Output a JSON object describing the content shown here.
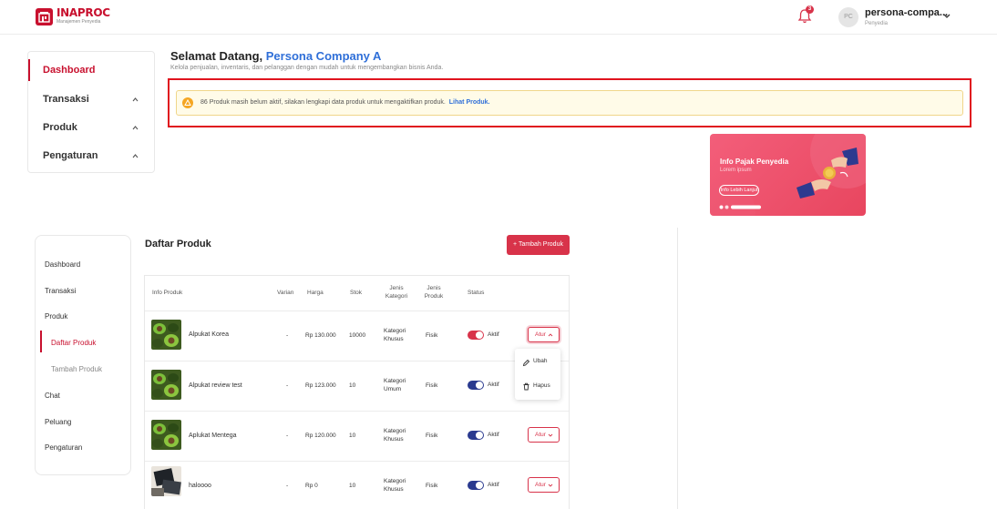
{
  "header": {
    "logo_title": "INAPROC",
    "logo_sub": "Manajemen Penyedia",
    "notification_count": "3",
    "avatar_initials": "PC",
    "user_name": "persona-compa...",
    "user_role": "Penyedia"
  },
  "top_sidebar": {
    "items": [
      {
        "label": "Dashboard"
      },
      {
        "label": "Transaksi"
      },
      {
        "label": "Produk"
      },
      {
        "label": "Pengaturan"
      }
    ]
  },
  "welcome": {
    "greeting": "Selamat Datang, ",
    "company": "Persona Company A",
    "subtitle": "Kelola penjualan, inventaris, dan pelanggan dengan mudah untuk mengembangkan bisnis Anda."
  },
  "notice": {
    "text": "86 Produk masih belum aktif, silakan lengkapi data produk untuk mengaktifkan produk.",
    "link": "Lihat Produk."
  },
  "banner": {
    "title": "Info Pajak Penyedia",
    "subtitle": "Lorem ipsum",
    "button": "Info Lebih Lanjut"
  },
  "bottom_sidebar": {
    "items": [
      {
        "label": "Dashboard"
      },
      {
        "label": "Transaksi"
      },
      {
        "label": "Produk"
      },
      {
        "label": "Daftar Produk"
      },
      {
        "label": "Tambah Produk"
      },
      {
        "label": "Chat"
      },
      {
        "label": "Peluang"
      },
      {
        "label": "Pengaturan"
      }
    ]
  },
  "product_list": {
    "title": "Daftar Produk",
    "add_button": "+ Tambah Produk",
    "columns": {
      "info": "Info Produk",
      "varian": "Varian",
      "harga": "Harga",
      "stok": "Stok",
      "jenis_kategori_1": "Jenis",
      "jenis_kategori_2": "Kategori",
      "jenis_produk_1": "Jenis",
      "jenis_produk_2": "Produk",
      "status": "Status"
    },
    "rows": [
      {
        "name": "Alpukat Korea",
        "varian": "-",
        "harga": "Rp 130.000",
        "stok": "10000",
        "kategori_1": "Kategori",
        "kategori_2": "Khusus",
        "produk": "Fisik",
        "status": "Aktif",
        "action": "Atur"
      },
      {
        "name": "Alpukat review test",
        "varian": "-",
        "harga": "Rp 123.000",
        "stok": "10",
        "kategori_1": "Kategori",
        "kategori_2": "Umum",
        "produk": "Fisik",
        "status": "Aktif",
        "action": "Atur"
      },
      {
        "name": "Aplukat Mentega",
        "varian": "-",
        "harga": "Rp 120.000",
        "stok": "10",
        "kategori_1": "Kategori",
        "kategori_2": "Khusus",
        "produk": "Fisik",
        "status": "Aktif",
        "action": "Atur"
      },
      {
        "name": "haloooo",
        "varian": "-",
        "harga": "Rp 0",
        "stok": "10",
        "kategori_1": "Kategori",
        "kategori_2": "Khusus",
        "produk": "Fisik",
        "status": "Aktif",
        "action": "Atur"
      }
    ],
    "dropdown": {
      "edit": "Ubah",
      "delete": "Hapus"
    }
  },
  "colors": {
    "brand_red": "#c8102e",
    "accent_red": "#d8334a",
    "link_blue": "#2f6fd8",
    "toggle_blue": "#2a3a8f",
    "highlight_frame": "#e0141e"
  }
}
